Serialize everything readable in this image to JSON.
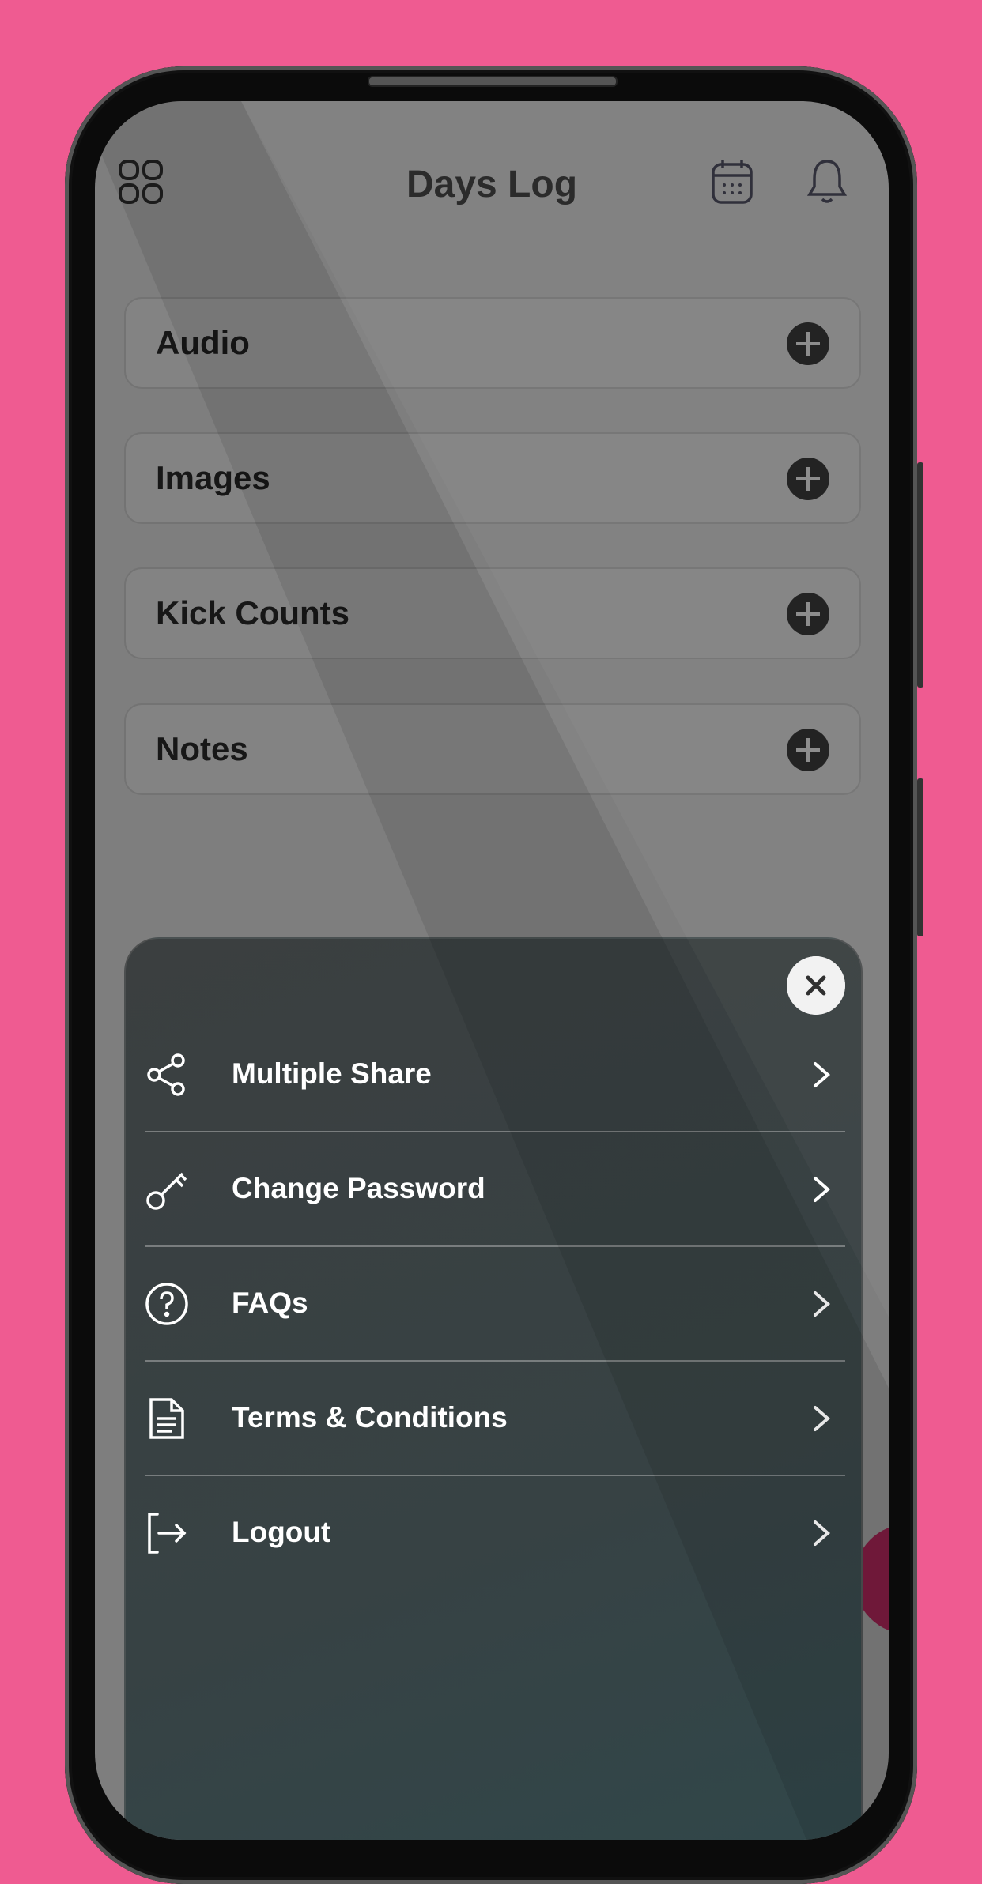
{
  "colors": {
    "background": "#ef5b91",
    "overlay_sheet": "#374244",
    "accent": "#7a1b3f"
  },
  "header": {
    "title": "Days Log",
    "left_icon": "grid-menu-icon",
    "right_icons": [
      "calendar-icon",
      "bell-icon"
    ]
  },
  "cards": [
    {
      "label": "Audio",
      "icon": "plus-circle-icon"
    },
    {
      "label": "Images",
      "icon": "plus-circle-icon"
    },
    {
      "label": "Kick Counts",
      "icon": "plus-circle-icon"
    },
    {
      "label": "Notes",
      "icon": "plus-circle-icon"
    }
  ],
  "menu": {
    "close_icon": "close-icon",
    "items": [
      {
        "label": "Multiple Share",
        "icon": "share-icon"
      },
      {
        "label": "Change Password",
        "icon": "key-icon"
      },
      {
        "label": "FAQs",
        "icon": "question-circle-icon"
      },
      {
        "label": "Terms & Conditions",
        "icon": "document-icon"
      },
      {
        "label": "Logout",
        "icon": "logout-icon"
      }
    ]
  }
}
